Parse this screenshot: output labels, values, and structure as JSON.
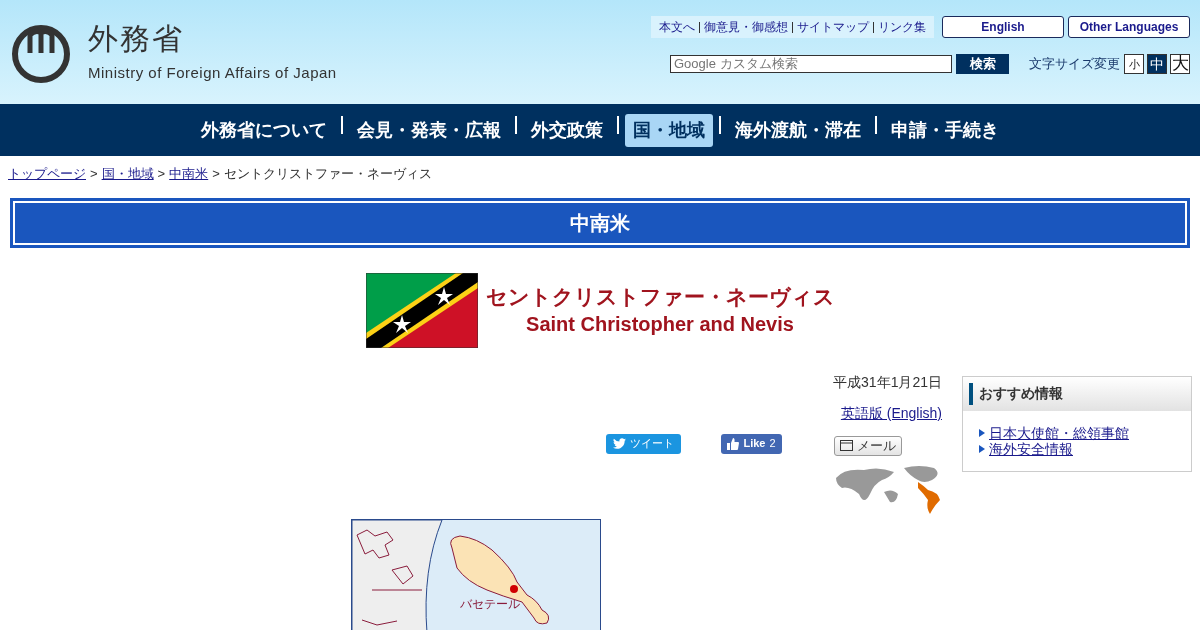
{
  "header": {
    "logo_title": "外務省",
    "logo_subtitle": "Ministry of Foreign Affairs of Japan",
    "util_links": [
      "本文へ",
      "御意見・御感想",
      "サイトマップ",
      "リンク集"
    ],
    "lang_buttons": [
      "English",
      "Other Languages"
    ],
    "search": {
      "placeholder": "Google カスタム検索",
      "button": "検索"
    },
    "font_size_label": "文字サイズ変更",
    "font_sizes": [
      {
        "label": "小",
        "selected": false
      },
      {
        "label": "中",
        "selected": true
      },
      {
        "label": "大",
        "selected": false
      }
    ]
  },
  "nav": [
    {
      "label": "外務省について",
      "selected": false
    },
    {
      "label": "会見・発表・広報",
      "selected": false
    },
    {
      "label": "外交政策",
      "selected": false
    },
    {
      "label": "国・地域",
      "selected": true
    },
    {
      "label": "海外渡航・滞在",
      "selected": false
    },
    {
      "label": "申請・手続き",
      "selected": false
    }
  ],
  "breadcrumb": {
    "links": [
      "トップページ",
      "国・地域",
      "中南米"
    ],
    "separators": [
      ">",
      ">",
      ">"
    ],
    "current": "セントクリストファー・ネーヴィス"
  },
  "region_heading": "中南米",
  "country": {
    "name_ja": "セントクリストファー・ネーヴィス",
    "name_en": "Saint Christopher and Nevis"
  },
  "date": "平成31年1月21日",
  "english_link": "英語版 (English)",
  "share": {
    "tweet": "ツイート",
    "like": "Like",
    "like_count": "2",
    "mail": "メール"
  },
  "map": {
    "capital_label": "バセテール"
  },
  "sidebar": {
    "title": "おすすめ情報",
    "links": [
      "日本大使館・総領事館",
      "海外安全情報"
    ]
  }
}
